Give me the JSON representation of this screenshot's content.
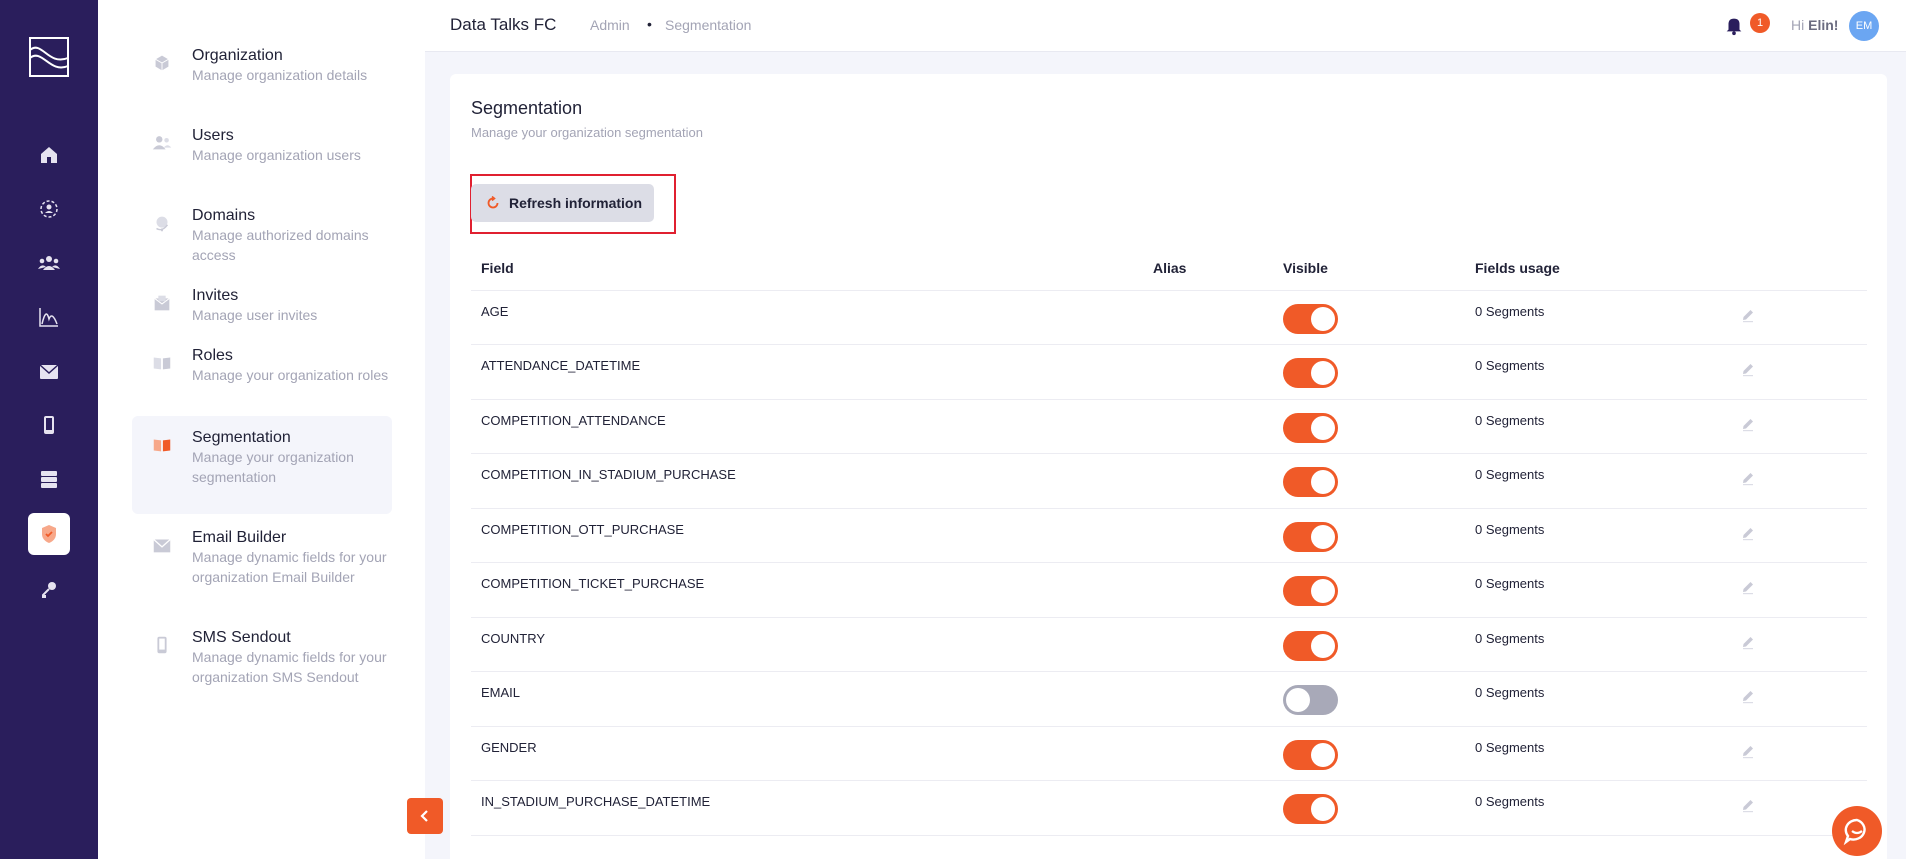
{
  "header": {
    "org_name": "Data Talks FC",
    "breadcrumb": [
      "Admin",
      "Segmentation"
    ],
    "breadcrumb_separator": "•",
    "notification_count": "1",
    "greeting_prefix": "Hi",
    "user_name": "Elin!",
    "avatar_initials": "EM"
  },
  "rail": {
    "icons": [
      "home-icon",
      "network-icon",
      "audience-icon",
      "analytics-icon",
      "email-icon",
      "mobile-icon",
      "database-icon",
      "shield-icon",
      "key-icon"
    ],
    "active": "shield-icon"
  },
  "subnav": {
    "items": [
      {
        "title": "Organization",
        "description": "Manage organization details",
        "icon": "cube-icon"
      },
      {
        "title": "Users",
        "description": "Manage organization users",
        "icon": "users-icon"
      },
      {
        "title": "Domains",
        "description": "Manage authorized domains access",
        "icon": "globe-icon"
      },
      {
        "title": "Invites",
        "description": "Manage user invites",
        "icon": "invite-icon"
      },
      {
        "title": "Roles",
        "description": "Manage your organization roles",
        "icon": "book-icon"
      },
      {
        "title": "Segmentation",
        "description": "Manage your organization segmentation",
        "icon": "segment-book-icon"
      },
      {
        "title": "Email Builder",
        "description": "Manage dynamic fields for your organization Email Builder",
        "icon": "email-builder-icon"
      },
      {
        "title": "SMS Sendout",
        "description": "Manage dynamic fields for your organization SMS Sendout",
        "icon": "phone-icon"
      }
    ],
    "active_index": 5
  },
  "main": {
    "title": "Segmentation",
    "subtitle": "Manage your organization segmentation",
    "refresh_label": "Refresh information",
    "columns": [
      "Field",
      "Alias",
      "Visible",
      "Fields usage"
    ],
    "rows": [
      {
        "field": "AGE",
        "alias": "",
        "visible": true,
        "usage": "0 Segments"
      },
      {
        "field": "ATTENDANCE_DATETIME",
        "alias": "",
        "visible": true,
        "usage": "0 Segments"
      },
      {
        "field": "COMPETITION_ATTENDANCE",
        "alias": "",
        "visible": true,
        "usage": "0 Segments"
      },
      {
        "field": "COMPETITION_IN_STADIUM_PURCHASE",
        "alias": "",
        "visible": true,
        "usage": "0 Segments"
      },
      {
        "field": "COMPETITION_OTT_PURCHASE",
        "alias": "",
        "visible": true,
        "usage": "0 Segments"
      },
      {
        "field": "COMPETITION_TICKET_PURCHASE",
        "alias": "",
        "visible": true,
        "usage": "0 Segments"
      },
      {
        "field": "COUNTRY",
        "alias": "",
        "visible": true,
        "usage": "0 Segments"
      },
      {
        "field": "EMAIL",
        "alias": "",
        "visible": false,
        "usage": "0 Segments"
      },
      {
        "field": "GENDER",
        "alias": "",
        "visible": true,
        "usage": "0 Segments"
      },
      {
        "field": "IN_STADIUM_PURCHASE_DATETIME",
        "alias": "",
        "visible": true,
        "usage": "0 Segments"
      }
    ]
  },
  "colors": {
    "accent": "#f05a28",
    "rail_bg": "#2a1e5c",
    "toggle_off": "#a8a9b8",
    "highlight_border": "#e02030"
  }
}
